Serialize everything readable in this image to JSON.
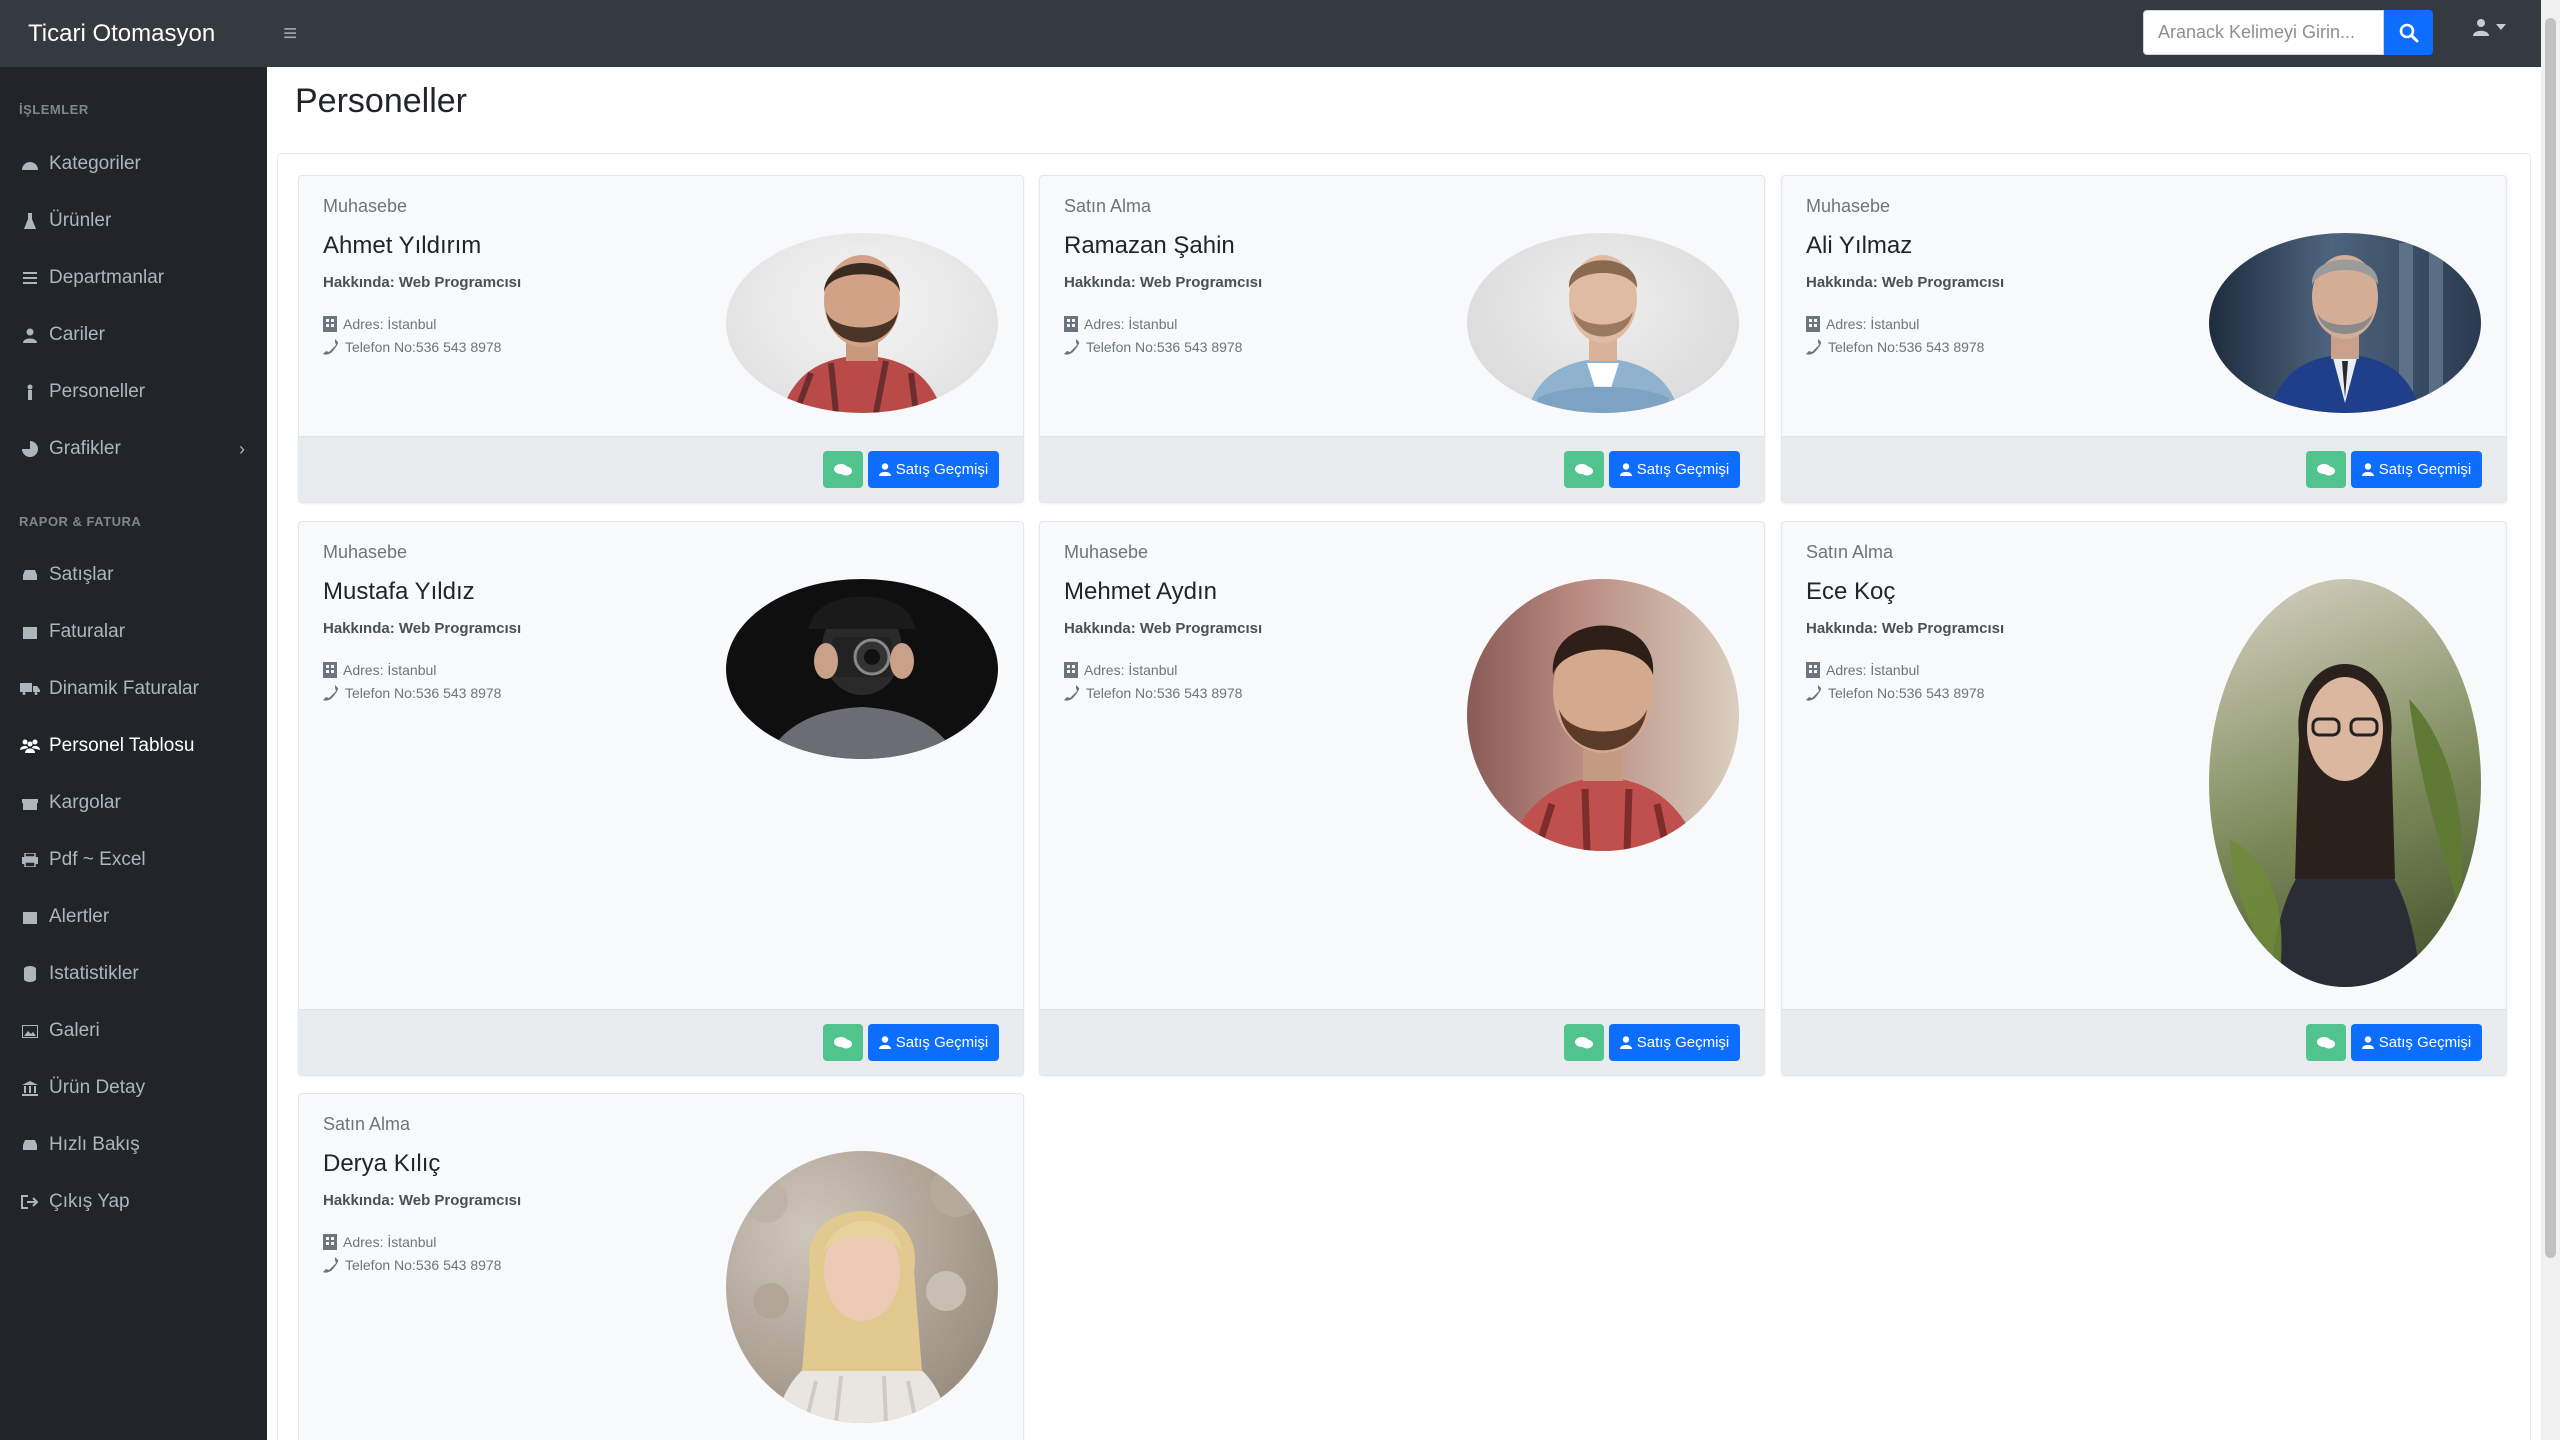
{
  "app": {
    "title": "Ticari Otomasyon"
  },
  "search": {
    "placeholder": "Aranack Kelimeyi Girin..."
  },
  "sidebar": {
    "heading_1": "İŞLEMLER",
    "heading_2": "RAPOR & FATURA",
    "items": [
      {
        "label": "Kategoriler",
        "icon": "tachometer-icon"
      },
      {
        "label": "Ürünler",
        "icon": "flask-icon"
      },
      {
        "label": "Departmanlar",
        "icon": "list-icon"
      },
      {
        "label": "Cariler",
        "icon": "user-icon"
      },
      {
        "label": "Personeller",
        "icon": "person-icon"
      },
      {
        "label": "Grafikler",
        "icon": "pie-chart-icon"
      },
      {
        "label": "Satışlar",
        "icon": "car-icon"
      },
      {
        "label": "Faturalar",
        "icon": "calendar-icon"
      },
      {
        "label": "Dinamik Faturalar",
        "icon": "truck-icon"
      },
      {
        "label": "Personel Tablosu",
        "icon": "people-icon"
      },
      {
        "label": "Kargolar",
        "icon": "gift-icon"
      },
      {
        "label": "Pdf ~ Excel",
        "icon": "print-icon"
      },
      {
        "label": "Alertler",
        "icon": "calendar-icon"
      },
      {
        "label": "Istatistikler",
        "icon": "database-icon"
      },
      {
        "label": "Galeri",
        "icon": "image-icon"
      },
      {
        "label": "Ürün Detay",
        "icon": "bank-icon"
      },
      {
        "label": "Hızlı Bakış",
        "icon": "car-icon"
      },
      {
        "label": "Çıkış Yap",
        "icon": "sign-out-icon"
      }
    ]
  },
  "page": {
    "title": "Personeller"
  },
  "cards": [
    {
      "dept": "Muhasebe",
      "name": "Ahmet Yıldırım",
      "about": "Hakkında: Web Programcısı",
      "addr": "Adres: İstanbul",
      "phone": "Telefon No:536 543 8978",
      "button": "Satış Geçmişi"
    },
    {
      "dept": "Satın Alma",
      "name": "Ramazan Şahin",
      "about": "Hakkında: Web Programcısı",
      "addr": "Adres: İstanbul",
      "phone": "Telefon No:536 543 8978",
      "button": "Satış Geçmişi"
    },
    {
      "dept": "Muhasebe",
      "name": "Ali Yılmaz",
      "about": "Hakkında: Web Programcısı",
      "addr": "Adres: İstanbul",
      "phone": "Telefon No:536 543 8978",
      "button": "Satış Geçmişi"
    },
    {
      "dept": "Muhasebe",
      "name": "Mustafa Yıldız",
      "about": "Hakkında: Web Programcısı",
      "addr": "Adres: İstanbul",
      "phone": "Telefon No:536 543 8978",
      "button": "Satış Geçmişi"
    },
    {
      "dept": "Muhasebe",
      "name": "Mehmet Aydın",
      "about": "Hakkında: Web Programcısı",
      "addr": "Adres: İstanbul",
      "phone": "Telefon No:536 543 8978",
      "button": "Satış Geçmişi"
    },
    {
      "dept": "Satın Alma",
      "name": "Ece Koç",
      "about": "Hakkında: Web Programcısı",
      "addr": "Adres: İstanbul",
      "phone": "Telefon No:536 543 8978",
      "button": "Satış Geçmişi"
    },
    {
      "dept": "Satın Alma",
      "name": "Derya Kılıç",
      "about": "Hakkında: Web Programcısı",
      "addr": "Adres: İstanbul",
      "phone": "Telefon No:536 543 8978",
      "button": "Satış Geçmişi"
    }
  ],
  "colors": {
    "navbar": "#343a40",
    "sidebar": "#212529",
    "primary": "#0d6efd",
    "success": "#51c38d"
  }
}
